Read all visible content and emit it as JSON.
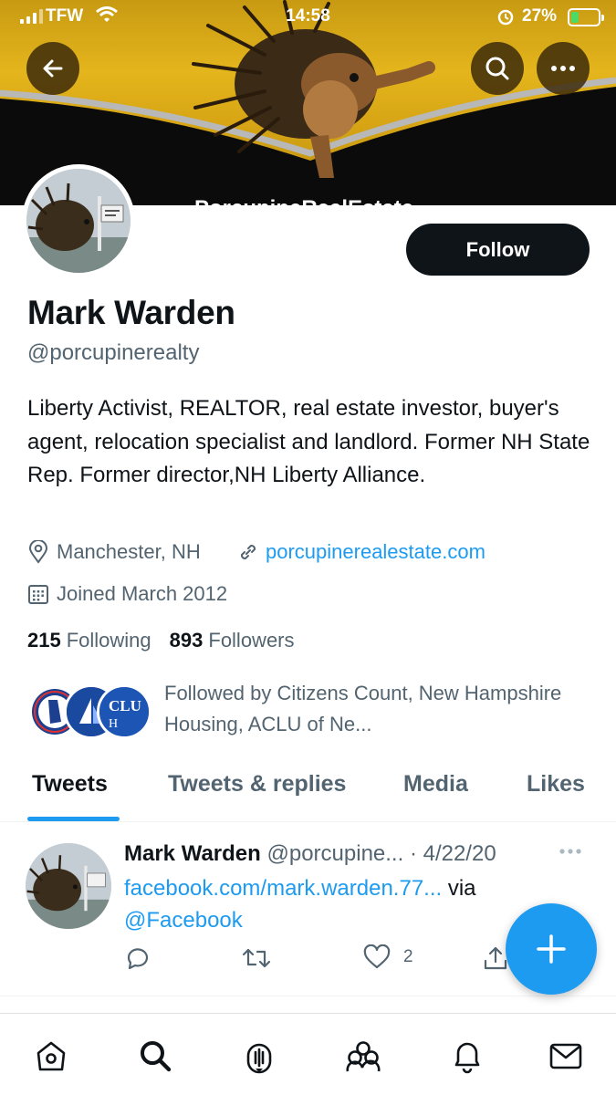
{
  "status_bar": {
    "carrier": "TFW",
    "time": "14:58",
    "battery_percent": "27%",
    "battery_level": 0.27,
    "icons": [
      "signal-icon",
      "wifi-icon",
      "alarm-icon",
      "battery-charging-icon"
    ]
  },
  "header": {
    "back_icon": "arrow-left-icon",
    "search_icon": "search-icon",
    "more_icon": "more-horizontal-icon"
  },
  "profile": {
    "follow_label": "Follow",
    "display_name": "Mark Warden",
    "handle": "@porcupinerealty",
    "bio": "Liberty Activist, REALTOR, real estate investor, buyer's agent, relocation specialist and landlord. Former NH State Rep. Former director,NH Liberty Alliance.",
    "location": "Manchester, NH",
    "website": "porcupinerealestate.com",
    "joined": "Joined March 2012",
    "following_count": "215",
    "following_label": "Following",
    "followers_count": "893",
    "followers_label": "Followers",
    "followed_by": "Followed by Citizens Count, New Hampshire Housing, ACLU of Ne..."
  },
  "tabs": [
    {
      "label": "Tweets",
      "active": true
    },
    {
      "label": "Tweets & replies",
      "active": false
    },
    {
      "label": "Media",
      "active": false
    },
    {
      "label": "Likes",
      "active": false
    }
  ],
  "tweet": {
    "name": "Mark Warden",
    "handle": "@porcupine...",
    "date": "· 4/22/20",
    "link": "facebook.com/mark.warden.77...",
    "via": " via",
    "mention": "@Facebook",
    "like_count": "2"
  },
  "bottom_nav": [
    "home-icon",
    "search-icon",
    "spaces-icon",
    "communities-icon",
    "notifications-icon",
    "messages-icon"
  ],
  "colors": {
    "accent": "#1d9bf0",
    "text": "#0f1419",
    "muted": "#536471",
    "follow_button": "#0f1419",
    "banner_gold": "#e4b51c"
  }
}
